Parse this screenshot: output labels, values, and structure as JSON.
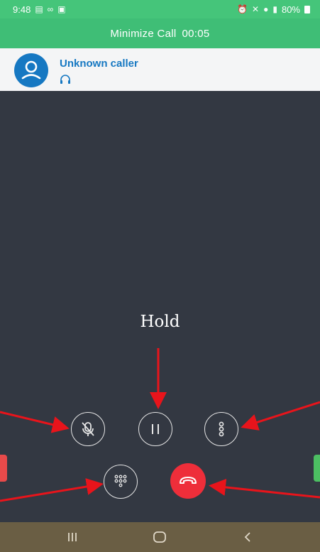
{
  "status_bar": {
    "time": "9:48",
    "left_icons": [
      "notification-icon",
      "voicemail-icon",
      "image-icon"
    ],
    "right_icons": [
      "alarm-icon",
      "mute-icon",
      "location-icon",
      "signal-icon"
    ],
    "battery_text": "80%"
  },
  "call_banner": {
    "label": "Minimize Call",
    "duration": "00:05"
  },
  "caller": {
    "name": "Unknown caller",
    "avatar_icon": "person-icon",
    "device_icon": "headset-icon"
  },
  "annotation": {
    "label": "Hold"
  },
  "controls": {
    "mute": "mic-off-icon",
    "hold": "pause-icon",
    "more": "more-vertical-icon",
    "keypad": "dialpad-icon",
    "end_call": "end-call-icon"
  },
  "nav_bar": {
    "recents": "recents-icon",
    "home": "home-icon",
    "back": "back-icon"
  },
  "colors": {
    "status_green": "#45c57a",
    "banner_green": "#3fbe76",
    "caller_blue": "#1678c2",
    "call_bg": "#333842",
    "end_red": "#ee2e3a",
    "arrow_red": "#e8141b",
    "nav_bg": "#6a5e44"
  }
}
